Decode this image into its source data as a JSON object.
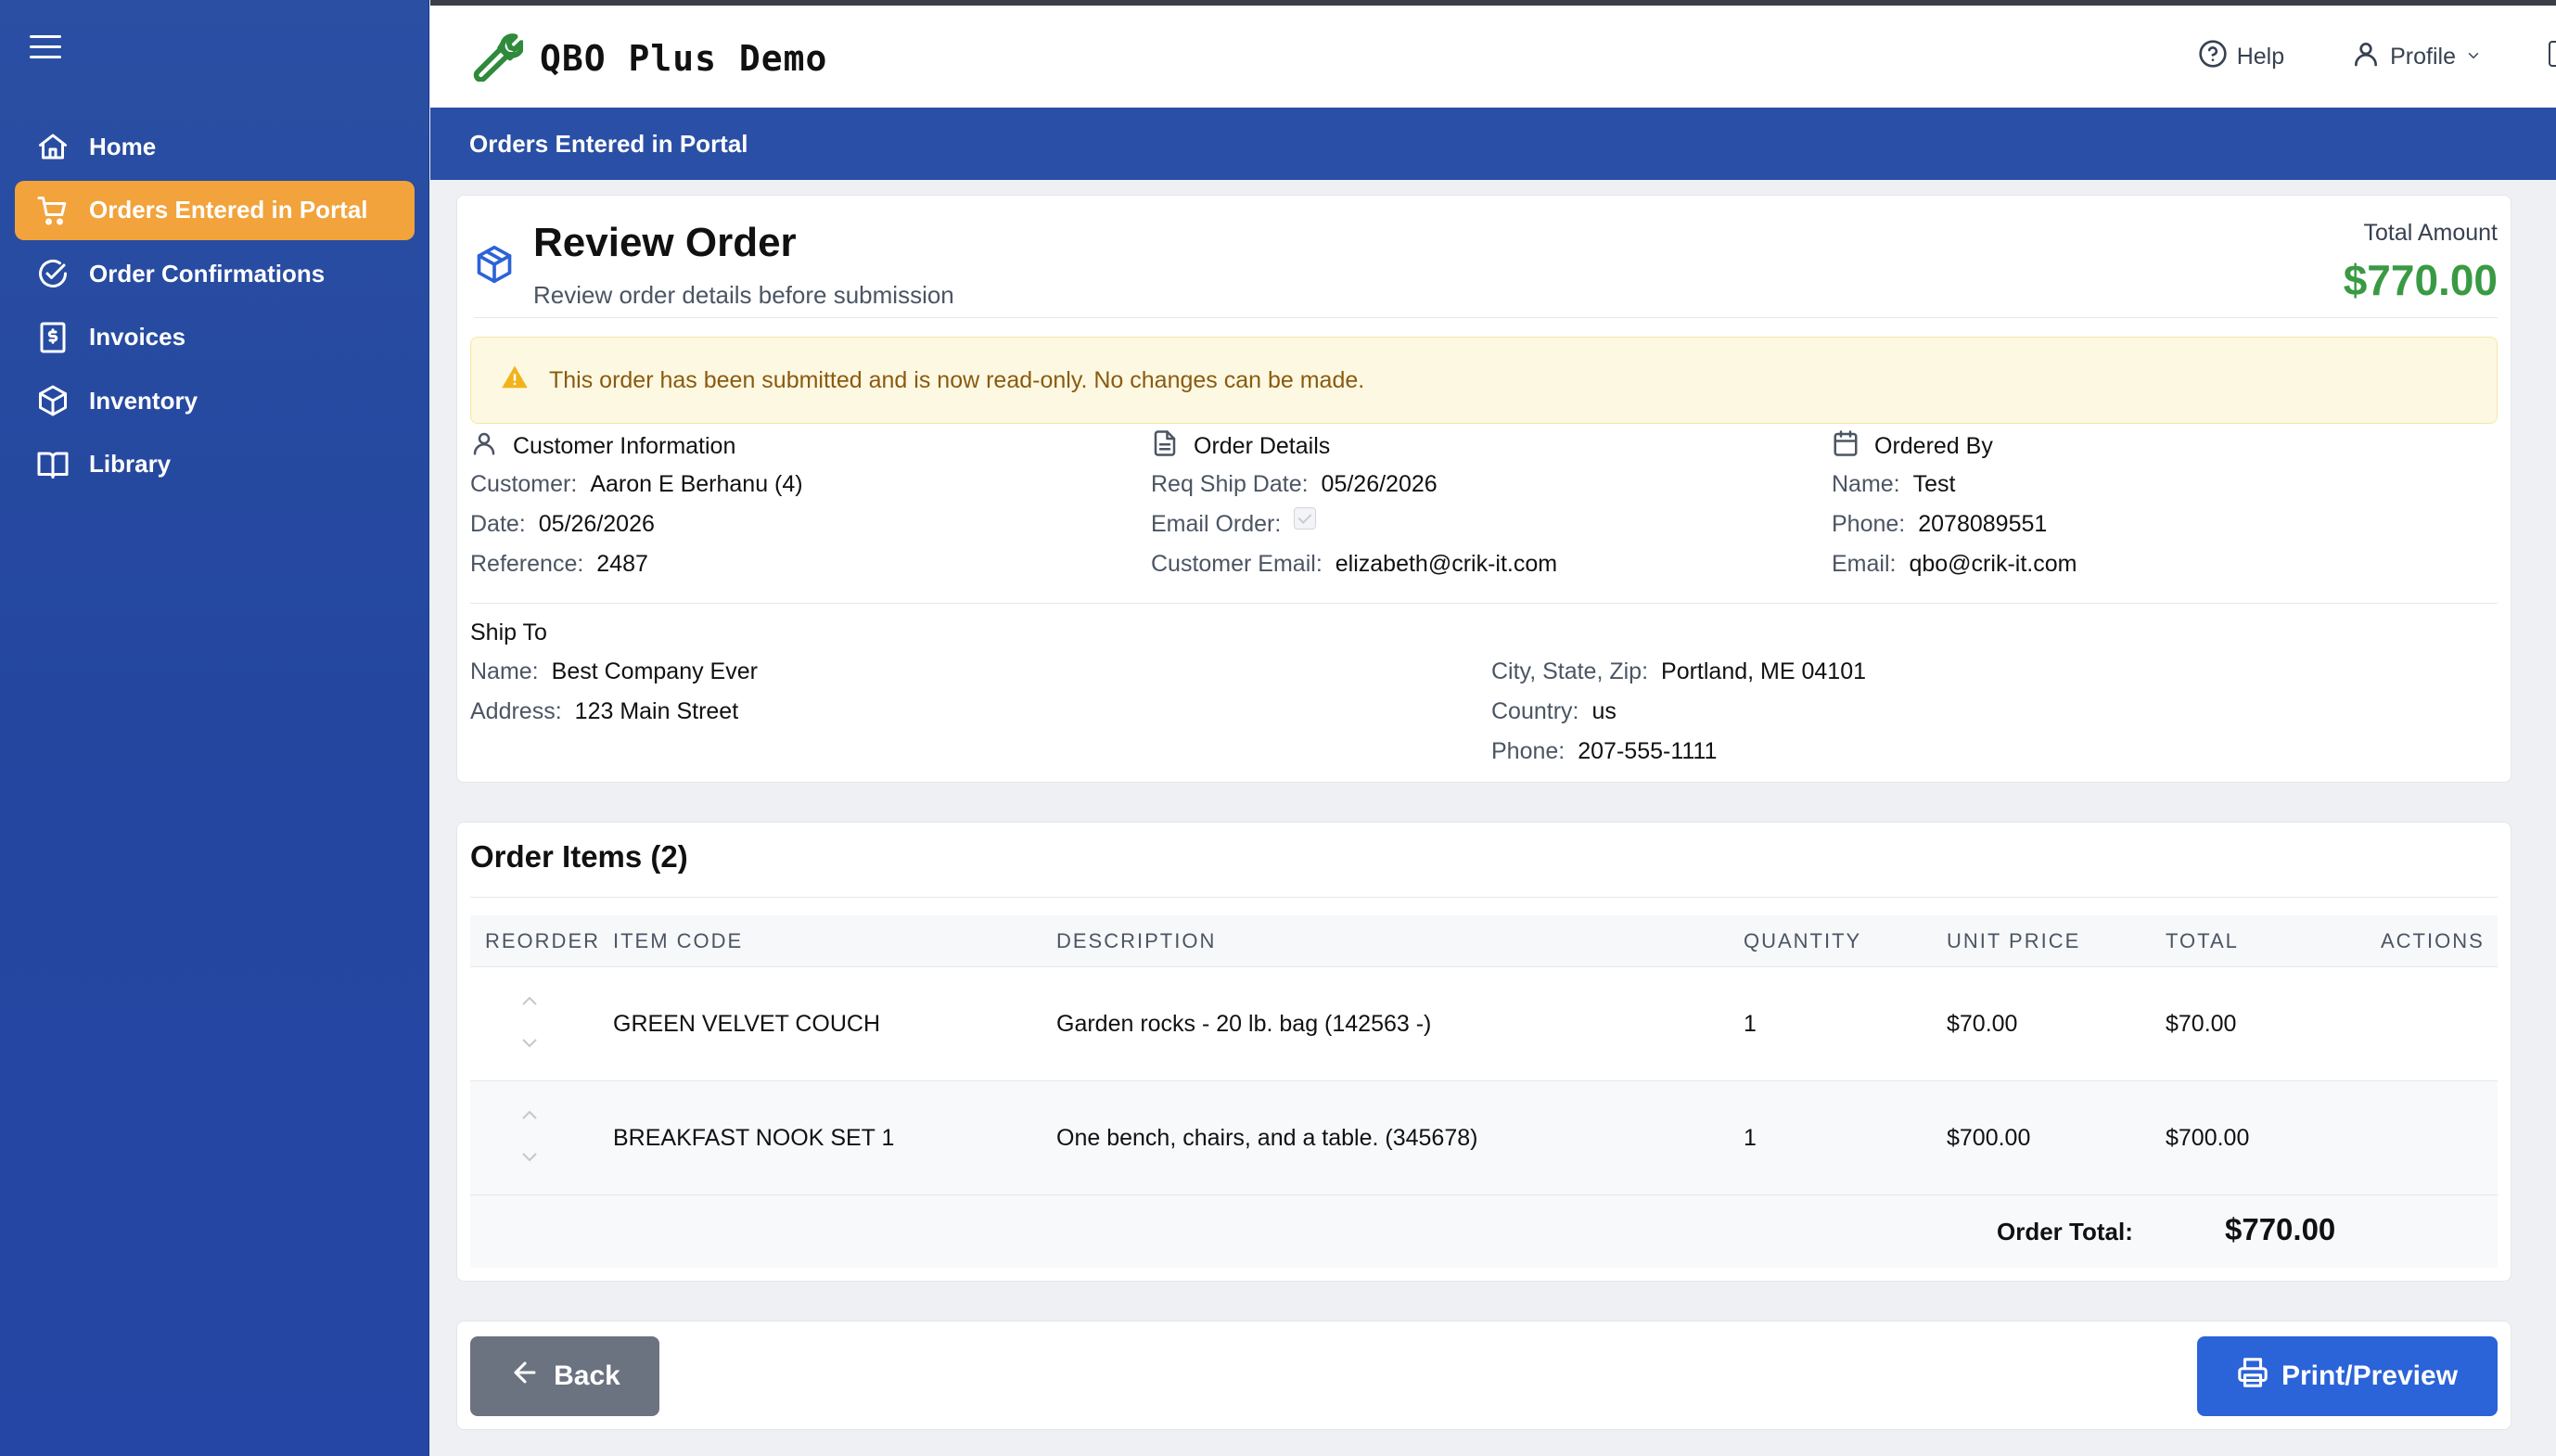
{
  "app": {
    "title": "QBO Plus Demo"
  },
  "sidebar": {
    "items": [
      {
        "label": "Home",
        "icon": "home-icon",
        "active": false
      },
      {
        "label": "Orders Entered in Portal",
        "icon": "cart-icon",
        "active": true
      },
      {
        "label": "Order Confirmations",
        "icon": "check-circle-icon",
        "active": false
      },
      {
        "label": "Invoices",
        "icon": "invoice-icon",
        "active": false
      },
      {
        "label": "Inventory",
        "icon": "cube-icon",
        "active": false
      },
      {
        "label": "Library",
        "icon": "book-icon",
        "active": false
      }
    ]
  },
  "header": {
    "help_label": "Help",
    "profile_label": "Profile"
  },
  "pagebar": {
    "title": "Orders Entered in Portal"
  },
  "review": {
    "title": "Review Order",
    "subtitle": "Review order details before submission",
    "total_label": "Total Amount",
    "total_value": "$770.00"
  },
  "alert": {
    "message": "This order has been submitted and is now read-only. No changes can be made."
  },
  "customer_info": {
    "heading": "Customer Information",
    "customer_label": "Customer:",
    "customer_value": "Aaron E Berhanu (4)",
    "date_label": "Date:",
    "date_value": "05/26/2026",
    "reference_label": "Reference:",
    "reference_value": "2487"
  },
  "order_details": {
    "heading": "Order Details",
    "ship_date_label": "Req Ship Date:",
    "ship_date_value": "05/26/2026",
    "email_order_label": "Email Order:",
    "customer_email_label": "Customer Email:",
    "customer_email_value": "elizabeth@crik-it.com"
  },
  "ordered_by": {
    "heading": "Ordered By",
    "name_label": "Name:",
    "name_value": "Test",
    "phone_label": "Phone:",
    "phone_value": "2078089551",
    "email_label": "Email:",
    "email_value": "qbo@crik-it.com"
  },
  "ship_to": {
    "heading": "Ship To",
    "name_label": "Name:",
    "name_value": "Best Company Ever",
    "address_label": "Address:",
    "address_value": "123 Main Street",
    "city_label": "City, State, Zip:",
    "city_value": "Portland, ME 04101",
    "country_label": "Country:",
    "country_value": "us",
    "phone_label": "Phone:",
    "phone_value": "207-555-1111"
  },
  "items": {
    "title": "Order Items (2)",
    "columns": [
      "REORDER",
      "ITEM CODE",
      "DESCRIPTION",
      "QUANTITY",
      "UNIT PRICE",
      "TOTAL",
      "ACTIONS"
    ],
    "rows": [
      {
        "code": "GREEN VELVET COUCH",
        "description": "Garden rocks - 20 lb. bag (142563 -)",
        "quantity": "1",
        "unit_price": "$70.00",
        "total": "$70.00"
      },
      {
        "code": "BREAKFAST NOOK SET 1",
        "description": "One bench, chairs, and a table. (345678)",
        "quantity": "1",
        "unit_price": "$700.00",
        "total": "$700.00"
      }
    ],
    "order_total_label": "Order Total:",
    "order_total_value": "$770.00"
  },
  "actions": {
    "back_label": "Back",
    "print_label": "Print/Preview"
  },
  "colors": {
    "sidebar": "#2a4fa3",
    "active_nav": "#f2a33c",
    "total_green": "#3a9a44",
    "primary_button": "#2b63d8",
    "back_button": "#6b7280"
  }
}
